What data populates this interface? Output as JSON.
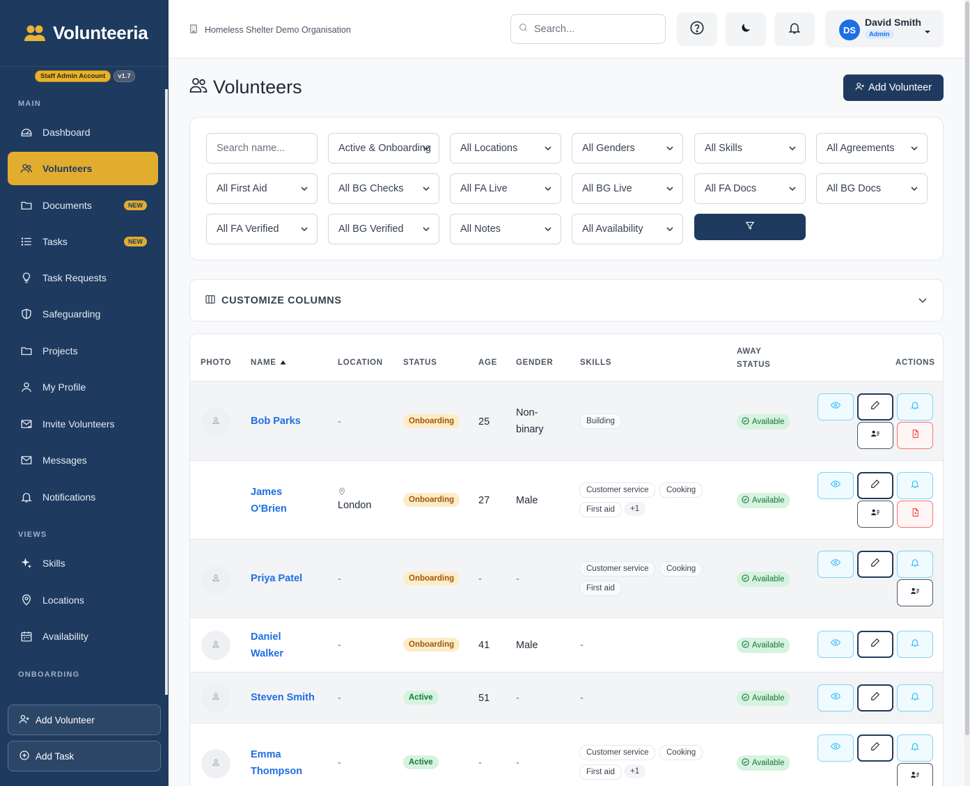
{
  "brand": {
    "name": "Volunteeria",
    "account_badge": "Staff Admin Account",
    "version": "v1.7"
  },
  "sidebar": {
    "sections": {
      "main": "MAIN",
      "views": "VIEWS",
      "onboarding": "ONBOARDING"
    },
    "main_items": [
      {
        "label": "Dashboard",
        "icon": "dashboard-icon"
      },
      {
        "label": "Volunteers",
        "icon": "users-icon",
        "active": true
      },
      {
        "label": "Documents",
        "icon": "folder-icon",
        "badge": "NEW"
      },
      {
        "label": "Tasks",
        "icon": "list-icon",
        "badge": "NEW"
      },
      {
        "label": "Task Requests",
        "icon": "lightbulb-icon"
      },
      {
        "label": "Safeguarding",
        "icon": "shield-icon"
      },
      {
        "label": "Projects",
        "icon": "folder-icon"
      },
      {
        "label": "My Profile",
        "icon": "user-icon"
      },
      {
        "label": "Invite Volunteers",
        "icon": "mail-send-icon"
      },
      {
        "label": "Messages",
        "icon": "mail-icon"
      },
      {
        "label": "Notifications",
        "icon": "bell-icon"
      }
    ],
    "view_items": [
      {
        "label": "Skills",
        "icon": "sparkle-icon"
      },
      {
        "label": "Locations",
        "icon": "pin-icon"
      },
      {
        "label": "Availability",
        "icon": "calendar-icon"
      }
    ],
    "actions": {
      "add_volunteer": "Add Volunteer",
      "add_task": "Add Task"
    }
  },
  "topbar": {
    "organisation": "Homeless Shelter Demo Organisation",
    "search_placeholder": "Search...",
    "user": {
      "initials": "DS",
      "name": "David Smith",
      "role": "Admin"
    }
  },
  "page": {
    "title": "Volunteers",
    "add_button": "Add Volunteer"
  },
  "filters": {
    "search_placeholder": "Search name...",
    "row1": [
      "Active & Onboarding",
      "All Locations",
      "All Genders",
      "All Skills",
      "All Agreements"
    ],
    "row2": [
      "All First Aid",
      "All BG Checks",
      "All FA Live",
      "All BG Live",
      "All FA Docs",
      "All BG Docs"
    ],
    "row3": [
      "All FA Verified",
      "All BG Verified",
      "All Notes",
      "All Availability"
    ]
  },
  "customize": {
    "label": "CUSTOMIZE COLUMNS"
  },
  "table": {
    "headers": {
      "photo": "PHOTO",
      "name": "NAME",
      "location": "LOCATION",
      "status": "STATUS",
      "age": "AGE",
      "gender": "GENDER",
      "skills": "SKILLS",
      "away_1": "AWAY",
      "away_2": "STATUS",
      "actions": "ACTIONS"
    },
    "rows": [
      {
        "name_1": "Bob Parks",
        "name_2": "",
        "location": "-",
        "status": "Onboarding",
        "age": "25",
        "gender_1": "Non-",
        "gender_2": "binary",
        "skills": [
          "Building"
        ],
        "away": "Available"
      },
      {
        "name_1": "James",
        "name_2": "O'Brien",
        "location": "London",
        "status": "Onboarding",
        "age": "27",
        "gender_1": "Male",
        "gender_2": "",
        "skills": [
          "Customer service",
          "Cooking",
          "First aid",
          "+1"
        ],
        "away": "Available"
      },
      {
        "name_1": "Priya Patel",
        "name_2": "",
        "location": "-",
        "status": "Onboarding",
        "age": "-",
        "gender_1": "-",
        "gender_2": "",
        "skills": [
          "Customer service",
          "Cooking",
          "First aid"
        ],
        "away": "Available"
      },
      {
        "name_1": "Daniel",
        "name_2": "Walker",
        "location": "-",
        "status": "Onboarding",
        "age": "41",
        "gender_1": "Male",
        "gender_2": "",
        "skills_text": "-",
        "away": "Available"
      },
      {
        "name_1": "Steven Smith",
        "name_2": "",
        "location": "-",
        "status": "Active",
        "age": "51",
        "gender_1": "-",
        "gender_2": "",
        "skills_text": "-",
        "away": "Available"
      },
      {
        "name_1": "Emma",
        "name_2": "Thompson",
        "location": "-",
        "status": "Active",
        "age": "-",
        "gender_1": "-",
        "gender_2": "",
        "skills": [
          "Customer service",
          "Cooking",
          "First aid",
          "+1"
        ],
        "away": "Available"
      }
    ]
  },
  "colors": {
    "navy": "#1e3a5f",
    "gold": "#e2ad2f",
    "link": "#1d6fe3"
  }
}
